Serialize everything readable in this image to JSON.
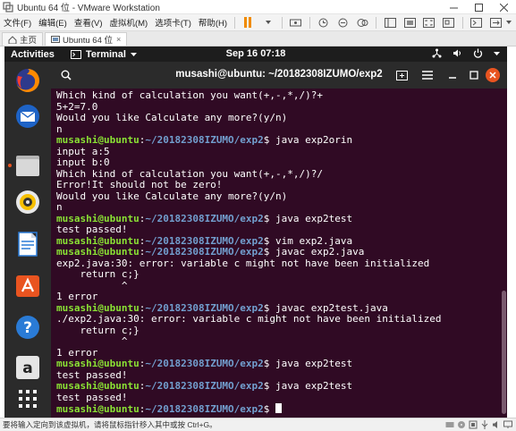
{
  "vmware": {
    "window_title": "Ubuntu 64 位 - VMware Workstation",
    "menus": [
      "文件(F)",
      "编辑(E)",
      "查看(V)",
      "虚拟机(M)",
      "选项卡(T)",
      "帮助(H)"
    ],
    "tabs": [
      {
        "label": "主页"
      },
      {
        "label": "Ubuntu 64 位",
        "close": "×"
      }
    ],
    "status_text": "要将输入定向到该虚拟机，请将鼠标指针移入其中或按 Ctrl+G。"
  },
  "ubuntu": {
    "activities": "Activities",
    "app_menu": "Terminal",
    "clock": "Sep 16  07:18"
  },
  "terminal": {
    "title": "musashi@ubuntu: ~/20182308IZUMO/exp2",
    "prompt_user": "musashi@ubuntu",
    "prompt_path": "~/20182308IZUMO/exp2",
    "lines": [
      {
        "text": "Which kind of calculation you want(+,-,*,/)?+"
      },
      {
        "text": "5+2=7.0"
      },
      {
        "text": "Would you like Calculate any more?(y/n)"
      },
      {
        "text": "n"
      },
      {
        "prompt": true,
        "cmd": " java exp2orin"
      },
      {
        "text": "input a:5"
      },
      {
        "text": "input b:0"
      },
      {
        "text": "Which kind of calculation you want(+,-,*,/)?/"
      },
      {
        "text": "Error!It should not be zero!"
      },
      {
        "text": "Would you like Calculate any more?(y/n)"
      },
      {
        "text": "n"
      },
      {
        "prompt": true,
        "cmd": " java exp2test"
      },
      {
        "text": "test passed!"
      },
      {
        "prompt": true,
        "cmd": " vim exp2.java"
      },
      {
        "prompt": true,
        "cmd": " javac exp2.java"
      },
      {
        "text": "exp2.java:30: error: variable c might not have been initialized"
      },
      {
        "text": "    return c;}"
      },
      {
        "text": "           ^"
      },
      {
        "text": "1 error"
      },
      {
        "prompt": true,
        "cmd": " javac exp2test.java"
      },
      {
        "text": "./exp2.java:30: error: variable c might not have been initialized"
      },
      {
        "text": "    return c;}"
      },
      {
        "text": "           ^"
      },
      {
        "text": "1 error"
      },
      {
        "prompt": true,
        "cmd": " java exp2test"
      },
      {
        "text": "test passed!"
      },
      {
        "prompt": true,
        "cmd": " java exp2test"
      },
      {
        "text": "test passed!"
      },
      {
        "prompt": true,
        "cmd": " ",
        "cursor": true
      }
    ]
  },
  "colors": {
    "terminal_bg": "#300a24",
    "prompt_user": "#8ae234",
    "prompt_path": "#729fcf",
    "ubuntu_accent": "#e95420"
  },
  "icons": {
    "dock": [
      "firefox-icon",
      "thunderbird-icon",
      "files-icon",
      "rhythmbox-icon",
      "writer-icon",
      "software-icon",
      "help-icon",
      "amazon-icon",
      "show-apps-icon"
    ]
  }
}
